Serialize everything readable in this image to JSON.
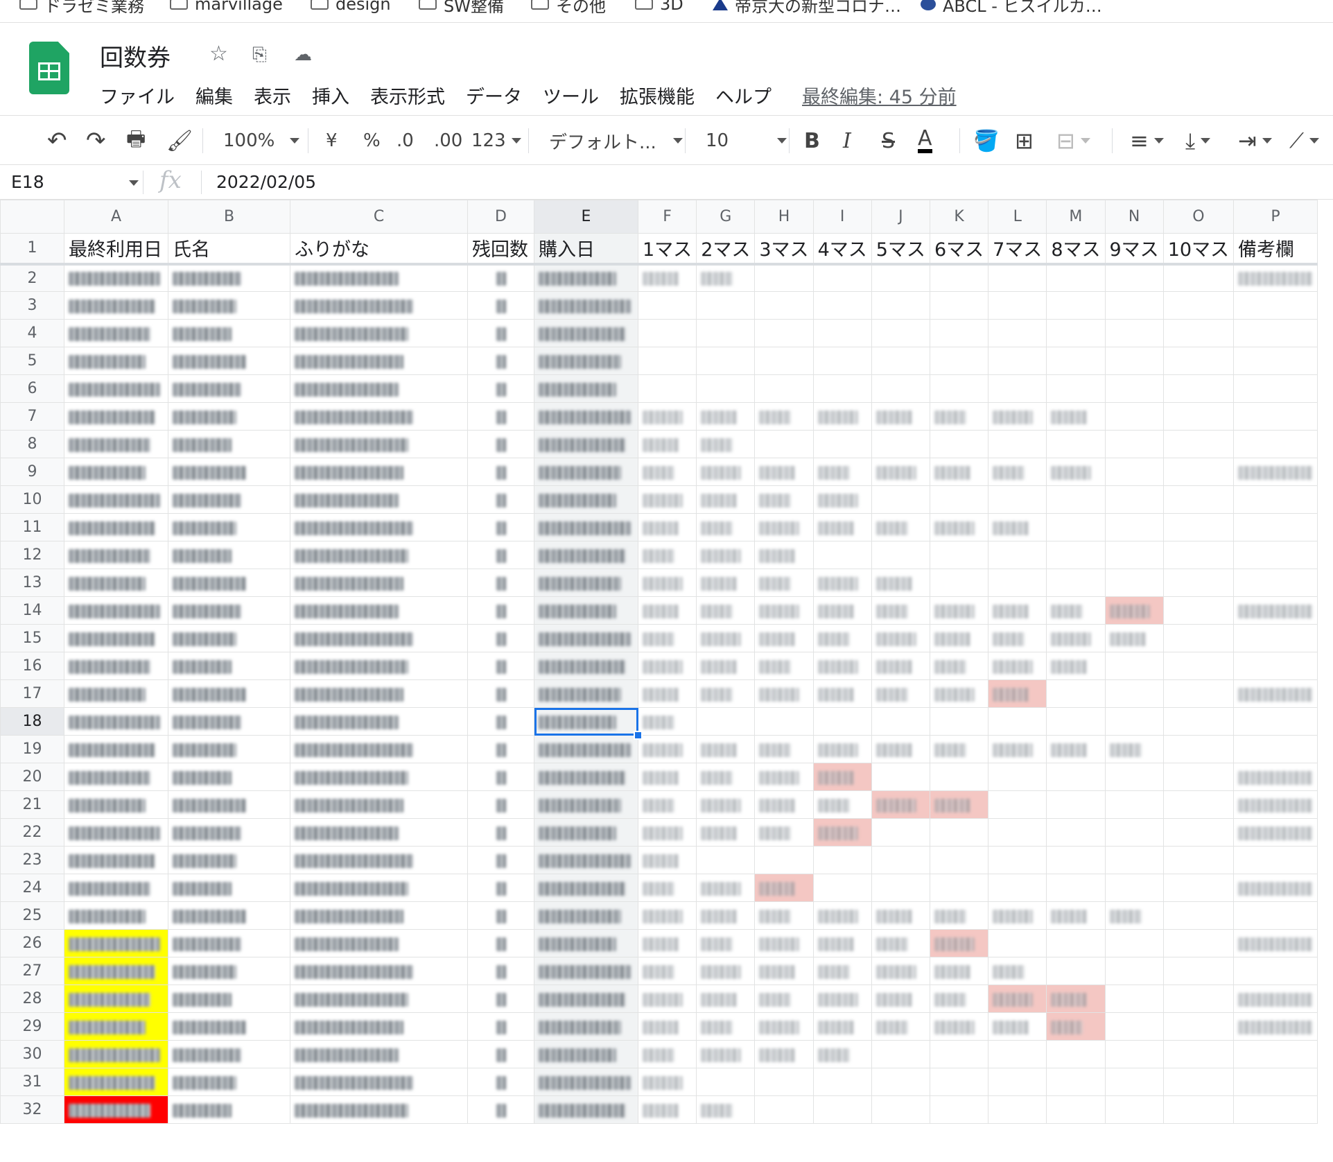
{
  "bookmarks": [
    "ドラゼミ業務",
    "marvillage",
    "design",
    "SW整備",
    "その他",
    "3D",
    "帝京大の新型コロナ…",
    "ABCL - ヒスイルカ…"
  ],
  "title": "回数券",
  "menu": [
    "ファイル",
    "編集",
    "表示",
    "挿入",
    "表示形式",
    "データ",
    "ツール",
    "拡張機能",
    "ヘルプ"
  ],
  "last_edit": "最終編集: 45 分前",
  "toolbar": {
    "zoom": "100%",
    "currency": "¥",
    "percent": "%",
    "dec_dec": ".0",
    "dec_inc": ".00",
    "format_more": "123",
    "font": "デフォルト...",
    "font_size": "10",
    "bold": "B",
    "italic": "I",
    "strike": "S",
    "text_color": "A"
  },
  "formula_bar": {
    "cell_ref": "E18",
    "fx": "fx",
    "value": "2022/02/05"
  },
  "columns": [
    "A",
    "B",
    "C",
    "D",
    "E",
    "F",
    "G",
    "H",
    "I",
    "J",
    "K",
    "L",
    "M",
    "N",
    "O",
    "P"
  ],
  "header_row": [
    "最終利用日",
    "氏名",
    "ふりがな",
    "残回数",
    "購入日",
    "1マス",
    "2マス",
    "3マス",
    "4マス",
    "5マス",
    "6マス",
    "7マス",
    "8マス",
    "9マス",
    "10マス",
    "備考欄"
  ],
  "rows": [
    {
      "n": "2",
      "fill": 2,
      "note": true
    },
    {
      "n": "3",
      "fill": 0
    },
    {
      "n": "4",
      "fill": 0
    },
    {
      "n": "5",
      "fill": 0
    },
    {
      "n": "6",
      "fill": 0
    },
    {
      "n": "7",
      "fill": 8
    },
    {
      "n": "8",
      "fill": 2
    },
    {
      "n": "9",
      "fill": 8,
      "note": true
    },
    {
      "n": "10",
      "fill": 4
    },
    {
      "n": "11",
      "fill": 7
    },
    {
      "n": "12",
      "fill": 3
    },
    {
      "n": "13",
      "fill": 5
    },
    {
      "n": "14",
      "fill": 9,
      "pink": [
        9
      ],
      "note": true
    },
    {
      "n": "15",
      "fill": 9
    },
    {
      "n": "16",
      "fill": 8
    },
    {
      "n": "17",
      "fill": 7,
      "pink": [
        7
      ],
      "note": true
    },
    {
      "n": "18",
      "fill": 1,
      "selected": true
    },
    {
      "n": "19",
      "fill": 9
    },
    {
      "n": "20",
      "fill": 4,
      "pink": [
        4
      ],
      "note": true
    },
    {
      "n": "21",
      "fill": 6,
      "pink": [
        5,
        6
      ],
      "note": true
    },
    {
      "n": "22",
      "fill": 4,
      "pink": [
        4
      ],
      "note": true
    },
    {
      "n": "23",
      "fill": 1
    },
    {
      "n": "24",
      "fill": 3,
      "pink": [
        3
      ],
      "note": true
    },
    {
      "n": "25",
      "fill": 9
    },
    {
      "n": "26",
      "fill": 6,
      "pink": [
        6
      ],
      "a": "yellow",
      "note": true
    },
    {
      "n": "27",
      "fill": 7,
      "a": "yellow"
    },
    {
      "n": "28",
      "fill": 8,
      "pink": [
        7,
        8
      ],
      "a": "yellow",
      "note": true
    },
    {
      "n": "29",
      "fill": 8,
      "pink": [
        8
      ],
      "a": "yellow",
      "note": true
    },
    {
      "n": "30",
      "fill": 4,
      "a": "yellow"
    },
    {
      "n": "31",
      "fill": 1,
      "a": "yellow"
    },
    {
      "n": "32",
      "fill": 2,
      "a": "red"
    }
  ],
  "colors": {
    "pink": "#f4c7c3",
    "yellow": "#ffff00",
    "red": "#ff0000",
    "selection": "#1a73e8",
    "brand": "#1fa463"
  }
}
